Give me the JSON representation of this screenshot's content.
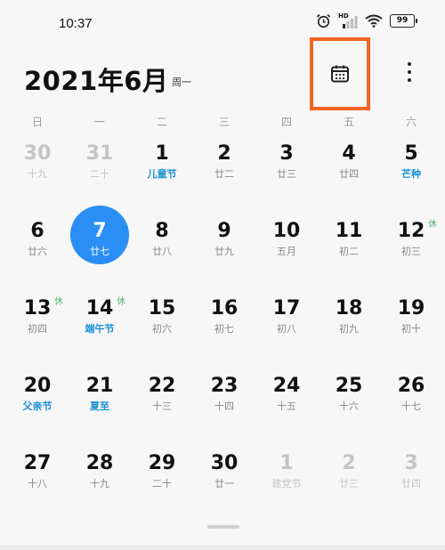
{
  "status": {
    "time": "10:37",
    "signal_label": "HD",
    "battery": "99"
  },
  "header": {
    "title": "2021年6月",
    "weekday": "周一"
  },
  "weekdays": [
    "日",
    "一",
    "二",
    "三",
    "四",
    "五",
    "六"
  ],
  "days": [
    {
      "num": "30",
      "sub": "十九",
      "dim": true
    },
    {
      "num": "31",
      "sub": "二十",
      "dim": true
    },
    {
      "num": "1",
      "sub": "儿童节",
      "festival": true
    },
    {
      "num": "2",
      "sub": "廿二"
    },
    {
      "num": "3",
      "sub": "廿三"
    },
    {
      "num": "4",
      "sub": "廿四"
    },
    {
      "num": "5",
      "sub": "芒种",
      "festival": true
    },
    {
      "num": "6",
      "sub": "廿六"
    },
    {
      "num": "7",
      "sub": "廿七",
      "today": true
    },
    {
      "num": "8",
      "sub": "廿八"
    },
    {
      "num": "9",
      "sub": "廿九"
    },
    {
      "num": "10",
      "sub": "五月"
    },
    {
      "num": "11",
      "sub": "初二"
    },
    {
      "num": "12",
      "sub": "初三",
      "rest": "休"
    },
    {
      "num": "13",
      "sub": "初四",
      "rest": "休"
    },
    {
      "num": "14",
      "sub": "端午节",
      "festival": true,
      "rest": "休"
    },
    {
      "num": "15",
      "sub": "初六"
    },
    {
      "num": "16",
      "sub": "初七"
    },
    {
      "num": "17",
      "sub": "初八"
    },
    {
      "num": "18",
      "sub": "初九"
    },
    {
      "num": "19",
      "sub": "初十"
    },
    {
      "num": "20",
      "sub": "父亲节",
      "festival": true
    },
    {
      "num": "21",
      "sub": "夏至",
      "festival": true
    },
    {
      "num": "22",
      "sub": "十三"
    },
    {
      "num": "23",
      "sub": "十四"
    },
    {
      "num": "24",
      "sub": "十五"
    },
    {
      "num": "25",
      "sub": "十六"
    },
    {
      "num": "26",
      "sub": "十七"
    },
    {
      "num": "27",
      "sub": "十八"
    },
    {
      "num": "28",
      "sub": "十九"
    },
    {
      "num": "29",
      "sub": "二十"
    },
    {
      "num": "30",
      "sub": "廿一"
    },
    {
      "num": "1",
      "sub": "建党节",
      "dim": true,
      "festival": true
    },
    {
      "num": "2",
      "sub": "廿三",
      "dim": true
    },
    {
      "num": "3",
      "sub": "廿四",
      "dim": true
    }
  ],
  "colors": {
    "today": "#2a8ef5",
    "festival": "#1a8fd6",
    "rest": "#56b36b",
    "highlight_box": "#f26522"
  },
  "icons": {
    "calendar_button": "calendar-icon",
    "more_button": "more-vertical-icon"
  }
}
